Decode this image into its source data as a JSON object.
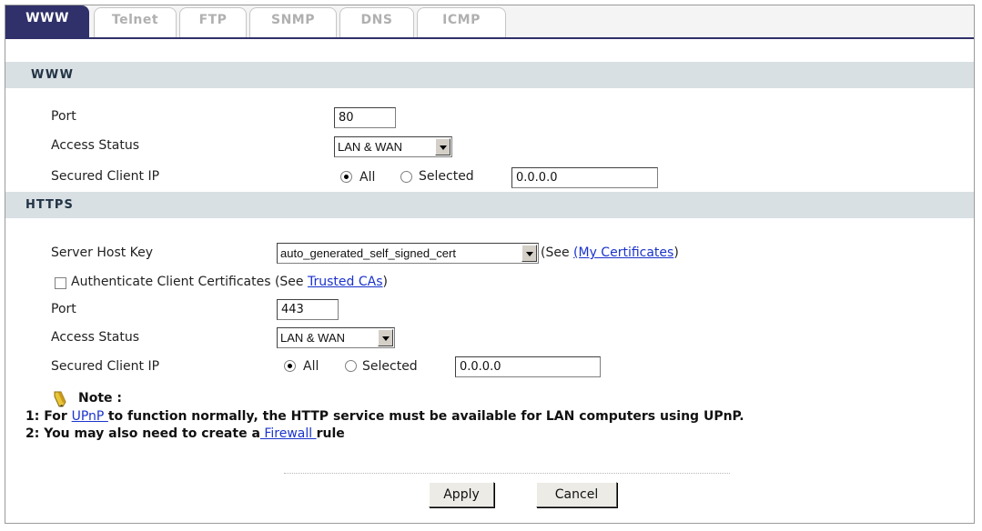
{
  "tabs": [
    "WWW",
    "Telnet",
    "FTP",
    "SNMP",
    "DNS",
    "ICMP"
  ],
  "www": {
    "header": "WWW",
    "port_label": "Port",
    "port_value": "80",
    "access_label": "Access Status",
    "access_value": "LAN & WAN",
    "client_ip_label": "Secured Client IP",
    "all_label": "All",
    "selected_label": "Selected",
    "ip_value": "0.0.0.0"
  },
  "https": {
    "header": "HTTPS",
    "host_key_label": "Server Host Key",
    "host_key_value": "auto_generated_self_signed_cert",
    "see_prefix": "(See ",
    "my_certificates_link": "(My Certificates",
    "see_suffix": ")",
    "auth_label": "Authenticate Client Certificates (See ",
    "trusted_cas_link": "Trusted CAs",
    "auth_suffix": ")",
    "port_label": "Port",
    "port_value": "443",
    "access_label": "Access Status",
    "access_value": "LAN & WAN",
    "client_ip_label": "Secured Client IP",
    "all_label": "All",
    "selected_label": "Selected",
    "ip_value": "0.0.0.0"
  },
  "note": {
    "title": "Note :",
    "line1_prefix": "1: For ",
    "line1_link": "UPnP ",
    "line1_suffix": "to function normally, the HTTP service must be available for LAN computers using UPnP.",
    "line2_prefix": "2: You may also need to create a",
    "line2_link": " Firewall ",
    "line2_suffix": "rule"
  },
  "buttons": {
    "apply": "Apply",
    "cancel": "Cancel"
  },
  "colors": {
    "tab_active": "#30306a",
    "section_bg": "#d9e0e4",
    "link": "#1a33cc"
  }
}
